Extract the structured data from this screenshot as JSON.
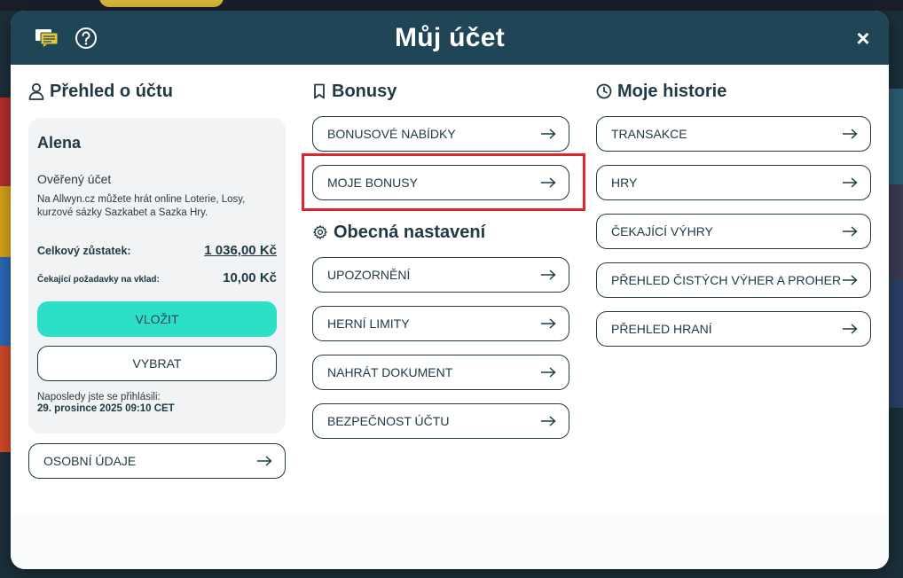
{
  "header": {
    "title": "Můj účet",
    "close_label": "×"
  },
  "account": {
    "section_title": "Přehled o účtu",
    "user_name": "Alena",
    "verified": "Ověřený účet",
    "info": "Na Allwyn.cz můžete hrát online Loterie, Losy, kurzové sázky Sazkabet a Sazka Hry.",
    "balance_label": "Celkový zůstatek:",
    "balance_value": "1 036,00 Kč",
    "pending_label": "Čekající požadavky na vklad:",
    "pending_value": "10,00 Kč",
    "deposit_label": "VLOŽIT",
    "withdraw_label": "VYBRAT",
    "last_login_label": "Naposledy jste se přihlásili:",
    "last_login_date": "29. prosince 2025 09:10 CET",
    "personal_data_label": "OSOBNÍ ÚDAJE"
  },
  "bonuses": {
    "section_title": "Bonusy",
    "items": [
      "BONUSOVÉ NABÍDKY",
      "MOJE BONUSY"
    ]
  },
  "settings": {
    "section_title": "Obecná nastavení",
    "items": [
      "UPOZORNĚNÍ",
      "HERNÍ LIMITY",
      "NAHRÁT DOKUMENT",
      "BEZPEČNOST ÚČTU"
    ]
  },
  "history": {
    "section_title": "Moje historie",
    "items": [
      "TRANSAKCE",
      "HRY",
      "ČEKAJÍCÍ VÝHRY",
      "PŘEHLED ČISTÝCH VÝHER A PROHER",
      "PŘEHLED HRANÍ"
    ]
  },
  "colors": {
    "header_bg": "#1f4556",
    "accent": "#2ddfc9",
    "text": "#203a44",
    "highlight": "#e0242e"
  }
}
